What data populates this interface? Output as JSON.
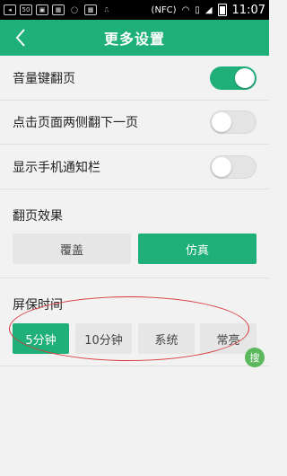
{
  "status_bar": {
    "signal_badge": "50",
    "nfc": "(NFC)",
    "time": "11:07"
  },
  "header": {
    "title": "更多设置"
  },
  "settings": [
    {
      "label": "音量键翻页",
      "state": "on"
    },
    {
      "label": "点击页面两侧翻下一页",
      "state": "off"
    },
    {
      "label": "显示手机通知栏",
      "state": "off"
    }
  ],
  "page_flip": {
    "label": "翻页效果",
    "options": [
      "覆盖",
      "仿真"
    ],
    "selected": "仿真"
  },
  "screen_saver": {
    "label": "屏保时间",
    "options": [
      "5分钟",
      "10分钟",
      "系统",
      "常亮"
    ],
    "selected": "5分钟"
  },
  "search_fab": {
    "label": "搜"
  },
  "colors": {
    "accent": "#1fb07a",
    "annotation": "#d8383a"
  }
}
